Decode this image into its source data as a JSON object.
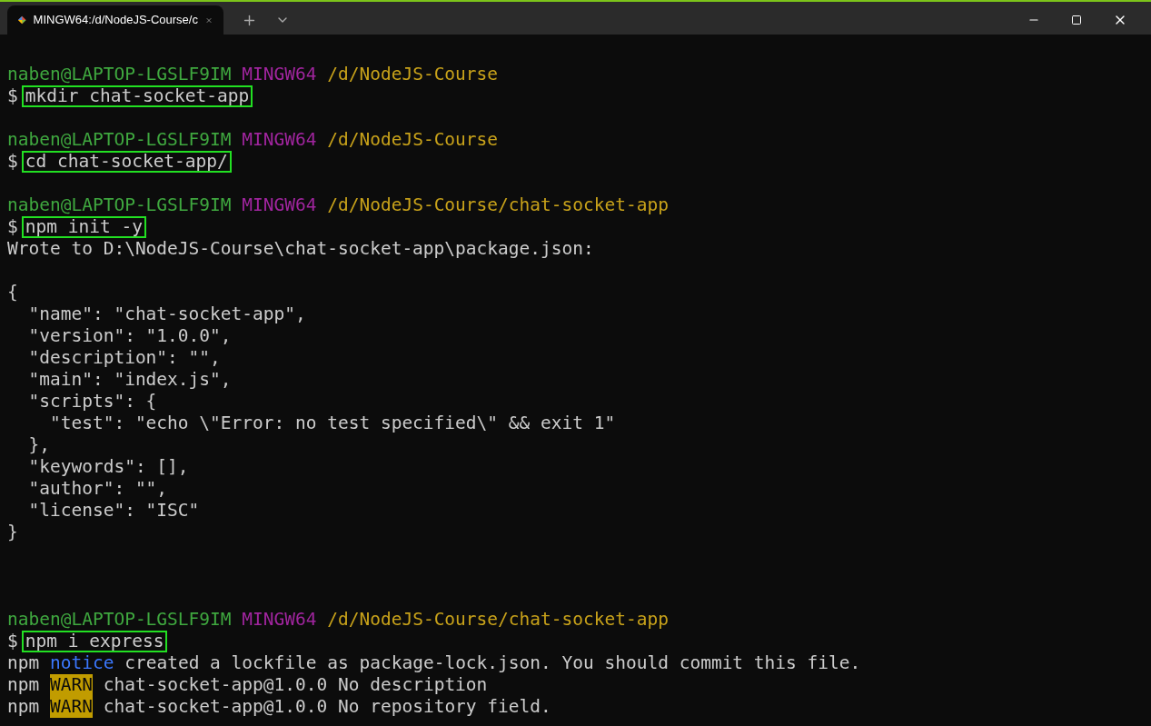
{
  "window": {
    "tab_title": "MINGW64:/d/NodeJS-Course/c",
    "tab_selected": true
  },
  "lines": [
    {
      "kind": "blank"
    },
    {
      "kind": "prompt",
      "user": "naben@LAPTOP-LGSLF9IM",
      "system": "MINGW64",
      "path": "/d/NodeJS-Course"
    },
    {
      "kind": "command",
      "symbol": "$",
      "text": "mkdir chat-socket-app"
    },
    {
      "kind": "blank"
    },
    {
      "kind": "prompt",
      "user": "naben@LAPTOP-LGSLF9IM",
      "system": "MINGW64",
      "path": "/d/NodeJS-Course"
    },
    {
      "kind": "command",
      "symbol": "$",
      "text": "cd chat-socket-app/"
    },
    {
      "kind": "blank"
    },
    {
      "kind": "prompt",
      "user": "naben@LAPTOP-LGSLF9IM",
      "system": "MINGW64",
      "path": "/d/NodeJS-Course/chat-socket-app"
    },
    {
      "kind": "command",
      "symbol": "$",
      "text": "npm init -y"
    },
    {
      "kind": "output",
      "text": "Wrote to D:\\NodeJS-Course\\chat-socket-app\\package.json:"
    },
    {
      "kind": "blank"
    },
    {
      "kind": "output",
      "text": "{"
    },
    {
      "kind": "output",
      "text": "  \"name\": \"chat-socket-app\","
    },
    {
      "kind": "output",
      "text": "  \"version\": \"1.0.0\","
    },
    {
      "kind": "output",
      "text": "  \"description\": \"\","
    },
    {
      "kind": "output",
      "text": "  \"main\": \"index.js\","
    },
    {
      "kind": "output",
      "text": "  \"scripts\": {"
    },
    {
      "kind": "output",
      "text": "    \"test\": \"echo \\\"Error: no test specified\\\" && exit 1\""
    },
    {
      "kind": "output",
      "text": "  },"
    },
    {
      "kind": "output",
      "text": "  \"keywords\": [],"
    },
    {
      "kind": "output",
      "text": "  \"author\": \"\","
    },
    {
      "kind": "output",
      "text": "  \"license\": \"ISC\""
    },
    {
      "kind": "output",
      "text": "}"
    },
    {
      "kind": "blank"
    },
    {
      "kind": "blank"
    },
    {
      "kind": "blank"
    },
    {
      "kind": "prompt",
      "user": "naben@LAPTOP-LGSLF9IM",
      "system": "MINGW64",
      "path": "/d/NodeJS-Course/chat-socket-app"
    },
    {
      "kind": "command",
      "symbol": "$",
      "text": "npm i express"
    },
    {
      "kind": "npm_log",
      "program": "npm",
      "tag": {
        "text": "notice",
        "kind": "notice"
      },
      "text": "created a lockfile as package-lock.json. You should commit this file."
    },
    {
      "kind": "npm_log",
      "program": "npm",
      "tag": {
        "text": "WARN",
        "kind": "warn"
      },
      "text": "chat-socket-app@1.0.0 No description"
    },
    {
      "kind": "npm_log",
      "program": "npm",
      "tag": {
        "text": "WARN",
        "kind": "warn"
      },
      "text": "chat-socket-app@1.0.0 No repository field."
    }
  ]
}
